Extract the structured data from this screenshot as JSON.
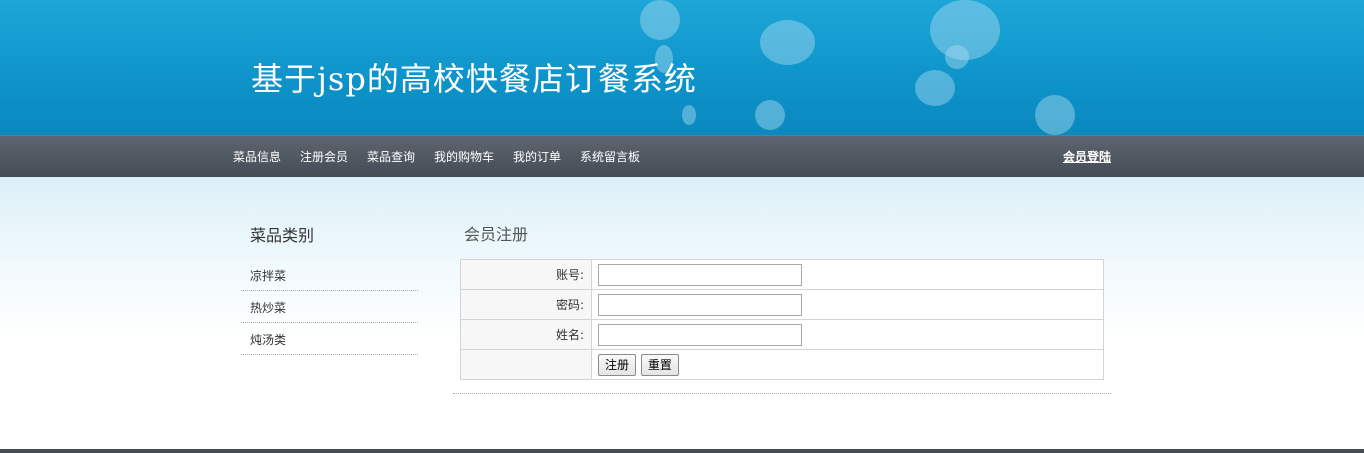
{
  "header": {
    "site_title": "基于jsp的高校快餐店订餐系统"
  },
  "nav": {
    "items": [
      "菜品信息",
      "注册会员",
      "菜品查询",
      "我的购物车",
      "我的订单",
      "系统留言板"
    ],
    "login": "会员登陆"
  },
  "sidebar": {
    "title": "菜品类别",
    "items": [
      "凉拌菜",
      "热炒菜",
      "炖汤类"
    ]
  },
  "main": {
    "title": "会员注册",
    "form": {
      "account_label": "账号:",
      "account_value": "",
      "password_label": "密码:",
      "password_value": "",
      "name_label": "姓名:",
      "name_value": "",
      "submit_label": "注册",
      "reset_label": "重置"
    }
  },
  "colors": {
    "header_blue": "#0d93c9",
    "nav_dark": "#444c55"
  }
}
